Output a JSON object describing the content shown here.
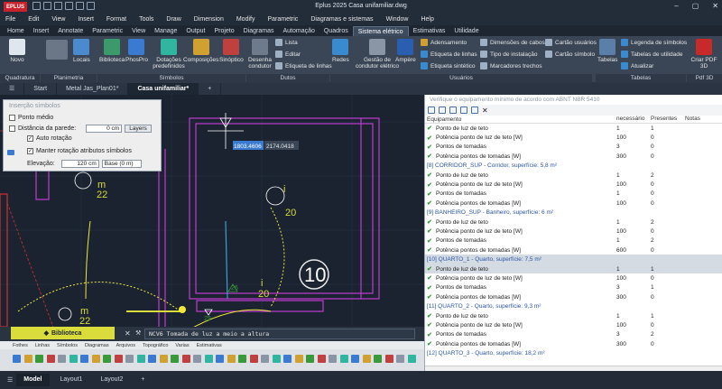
{
  "app": {
    "logo": "EPLUS",
    "title": "Eplus 2025   Casa unifamiliar.dwg",
    "min": "–",
    "max": "▢",
    "close": "✕"
  },
  "menu": [
    "File",
    "Edit",
    "View",
    "Insert",
    "Format",
    "Tools",
    "Draw",
    "Dimension",
    "Modify",
    "Parametric",
    "Diagramas e sistemas",
    "Window",
    "Help"
  ],
  "ribbon_tabs": [
    "Home",
    "Insert",
    "Annotate",
    "Parametric",
    "View",
    "Manage",
    "Output",
    "Projeto",
    "Diagramas",
    "Automação",
    "Quadros",
    "Sistema elétrico",
    "Estimativas",
    "Utilidade"
  ],
  "ribbon_active": "Sistema elétrico",
  "ribbon": {
    "groups": [
      "Quadratura",
      "Planimetria",
      "Símbolos",
      "Dutos",
      "Usuários",
      "Tabelas",
      "Pdf 3D"
    ],
    "novo": "Novo",
    "locais": "Locais",
    "biblioteca": "Biblioteca",
    "phospro": "PhosPro",
    "dotacoes": "Dotações predefinidos",
    "composicoes": "Composições",
    "sinoptico": "Sinóptico",
    "desenha_condutor": "Desenha condutor",
    "lista": "Lista",
    "editar": "Editar",
    "etiqueta_linhas": "Etiqueta de linhas",
    "redes": "Redes",
    "gestao_condutor": "Gestão de condutor elétrico",
    "ampere": "Ampère",
    "adensamento": "Adensamento",
    "etiqueta_linhas2": "Etiqueta de linhas",
    "etiqueta_sintetico": "Etiqueta sintético",
    "dimensoes_cabos": "Dimensões de cabos",
    "tipo_instalacao": "Tipo de instalação",
    "marcadores_trechos": "Marcadores trechos",
    "cartao_usuarios": "Cartão usuários",
    "cartao_simbolo": "Cartão símbolo",
    "tabelas": "Tabelas",
    "legenda_simbolos": "Legenda de símbolos",
    "tabelas_utilidade": "Tabelas de utilidade",
    "atualizar": "Atualizar",
    "criar_pdf": "Criar PDF 3D"
  },
  "doc_tabs": [
    "Start",
    "Metal Jas_Plan01*",
    "Casa unifamiliar*",
    "+"
  ],
  "doc_active": "Casa unifamiliar*",
  "symbol_panel": {
    "title": "Inserção símbolos",
    "ponto_medio": "Ponto médio",
    "distancia_label": "Distância da parede:",
    "distancia_value": "0 cm",
    "layers_btn": "Layers",
    "auto_rotacao": "Auto rotação",
    "manter_rotacao": "Manter rotação atributos símbolos",
    "elevacao_label": "Elevação:",
    "elevacao_value": "120 cm",
    "base_value": "Base (0 m)"
  },
  "canvas": {
    "coord_x": "1803.4606",
    "coord_y": "2174.0418",
    "room_num": "10",
    "label_m22_top": "m",
    "label_22_top": "22",
    "label_i20_right": "i",
    "label_20_right": "20",
    "label_i20_low": "i",
    "label_20_low": "20",
    "label_26": "26",
    "label_29": "29",
    "label_m22_bot": "m",
    "label_22_bot": "22"
  },
  "biblioteca_btn": "Biblioteca",
  "cmdline": {
    "prefix": "NCV6",
    "text": "Tomada de luz a meio a altura"
  },
  "bottom_tabs": [
    "Fothes",
    "Linhas",
    "Símbolos",
    "Diagramas",
    "Arquivos",
    "Topográfico",
    "Varias",
    "Estimativas"
  ],
  "layout_tabs": [
    "Model",
    "Layout1",
    "Layout2",
    "+"
  ],
  "layout_active": "Model",
  "checklist": {
    "title": "Verifique o equipamento mínimo de acordo com ABNT NBR 5410",
    "col_equip": "Equipamento",
    "col_nec": "necessário",
    "col_pres": "Presentes",
    "col_notas": "Notas",
    "rows": [
      {
        "type": "item",
        "name": "Ponto de luz de teto",
        "nec": "1",
        "pres": "1"
      },
      {
        "type": "item",
        "name": "Potência ponto de luz de teto [W]",
        "nec": "100",
        "pres": "0"
      },
      {
        "type": "item",
        "name": "Pontos de tomadas",
        "nec": "3",
        "pres": "0"
      },
      {
        "type": "item",
        "name": "Potência pontos de tomadas [W]",
        "nec": "300",
        "pres": "0"
      },
      {
        "type": "section",
        "name": "[8] CORRIDOR_SUP - Corridor, superfície: 5,8 m²"
      },
      {
        "type": "item",
        "name": "Ponto de luz de teto",
        "nec": "1",
        "pres": "2"
      },
      {
        "type": "item",
        "name": "Potência ponto de luz de teto [W]",
        "nec": "100",
        "pres": "0"
      },
      {
        "type": "item",
        "name": "Pontos de tomadas",
        "nec": "1",
        "pres": "0"
      },
      {
        "type": "item",
        "name": "Potência pontos de tomadas [W]",
        "nec": "100",
        "pres": "0"
      },
      {
        "type": "section",
        "name": "[9] BANHEIRO_SUP - Banheiro, superfície: 6 m²"
      },
      {
        "type": "item",
        "name": "Ponto de luz de teto",
        "nec": "1",
        "pres": "2"
      },
      {
        "type": "item",
        "name": "Potência ponto de luz de teto [W]",
        "nec": "100",
        "pres": "0"
      },
      {
        "type": "item",
        "name": "Pontos de tomadas",
        "nec": "1",
        "pres": "2"
      },
      {
        "type": "item",
        "name": "Potência pontos de tomadas [W]",
        "nec": "600",
        "pres": "0"
      },
      {
        "type": "section",
        "name": "[10] QUARTO_1 - Quarto, superfície: 7,5 m²",
        "hl": true
      },
      {
        "type": "item",
        "name": "Ponto de luz de teto",
        "nec": "1",
        "pres": "1",
        "hl": true
      },
      {
        "type": "item",
        "name": "Potência ponto de luz de teto [W]",
        "nec": "100",
        "pres": "0"
      },
      {
        "type": "item",
        "name": "Pontos de tomadas",
        "nec": "3",
        "pres": "1"
      },
      {
        "type": "item",
        "name": "Potência pontos de tomadas [W]",
        "nec": "300",
        "pres": "0"
      },
      {
        "type": "section",
        "name": "[11] QUARTO_2 - Quarto, superfície: 9,3 m²"
      },
      {
        "type": "item",
        "name": "Ponto de luz de teto",
        "nec": "1",
        "pres": "1"
      },
      {
        "type": "item",
        "name": "Potência ponto de luz de teto [W]",
        "nec": "100",
        "pres": "0"
      },
      {
        "type": "item",
        "name": "Pontos de tomadas",
        "nec": "3",
        "pres": "2"
      },
      {
        "type": "item",
        "name": "Potência pontos de tomadas [W]",
        "nec": "300",
        "pres": "0"
      },
      {
        "type": "section",
        "name": "[12] QUARTO_3 - Quarto, superfície: 18,2 m²"
      }
    ]
  },
  "colors": {
    "accent": "#d9dc3a",
    "magenta": "#c13bd0",
    "yellow": "#f0e83a",
    "red": "#d03030",
    "cyan": "#3aa0d0",
    "ok": "#3a9a3a"
  }
}
